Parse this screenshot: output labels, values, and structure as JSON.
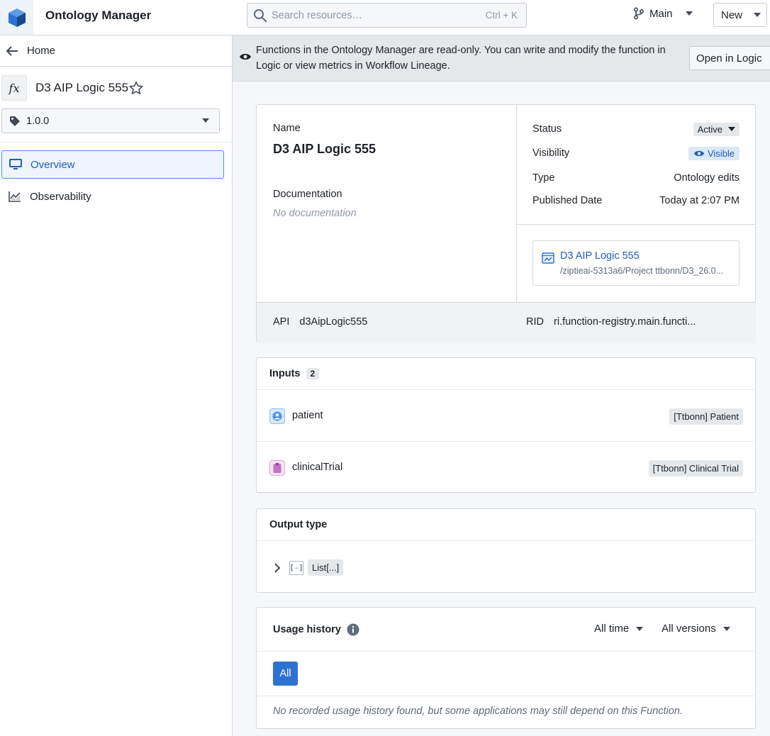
{
  "topbar": {
    "app_title": "Ontology Manager",
    "search_placeholder": "Search resources…",
    "search_shortcut": "Ctrl + K",
    "branch": "Main",
    "new_label": "New"
  },
  "sidebar": {
    "home_label": "Home",
    "function_icon_text": "fx",
    "function_title": "D3 AIP Logic 555",
    "version": "1.0.0",
    "nav": [
      {
        "label": "Overview",
        "active": true,
        "icon": "monitor-icon"
      },
      {
        "label": "Observability",
        "active": false,
        "icon": "chart-area-icon"
      }
    ]
  },
  "banner": {
    "message": "Functions in the Ontology Manager are read-only. You can write and modify the function in Logic or view metrics in Workflow Lineage.",
    "open_button": "Open in Logic"
  },
  "overview": {
    "name_label": "Name",
    "name_value": "D3 AIP Logic 555",
    "documentation_label": "Documentation",
    "documentation_value": "No documentation",
    "status_label": "Status",
    "status_value": "Active",
    "visibility_label": "Visibility",
    "visibility_value": "Visible",
    "type_label": "Type",
    "type_value": "Ontology edits",
    "published_label": "Published Date",
    "published_value": "Today at 2:07 PM",
    "resource_title": "D3 AIP Logic 555",
    "resource_path": "/ziptieai-5313a6/Project ttbonn/D3_26.0...",
    "api_label": "API",
    "api_value": "d3AipLogic555",
    "rid_label": "RID",
    "rid_value": "ri.function-registry.main.functi..."
  },
  "inputs": {
    "title": "Inputs",
    "count": "2",
    "items": [
      {
        "name": "patient",
        "type": "[Ttbonn] Patient",
        "icon": "user-icon",
        "color": "#4c90f0"
      },
      {
        "name": "clinicalTrial",
        "type": "[Ttbonn] Clinical Trial",
        "icon": "clipboard-icon",
        "color": "#c274c2"
      }
    ]
  },
  "output": {
    "title": "Output type",
    "icon_text": "[-]",
    "type": "List[...]"
  },
  "usage": {
    "title": "Usage history",
    "time_filter": "All time",
    "version_filter": "All versions",
    "all_button": "All",
    "empty_message": "No recorded usage history found, but some applications may still depend on this Function."
  },
  "colors": {
    "accent": "#2d72d2",
    "link": "#215db0",
    "banner_bg": "#e5e8eb"
  }
}
